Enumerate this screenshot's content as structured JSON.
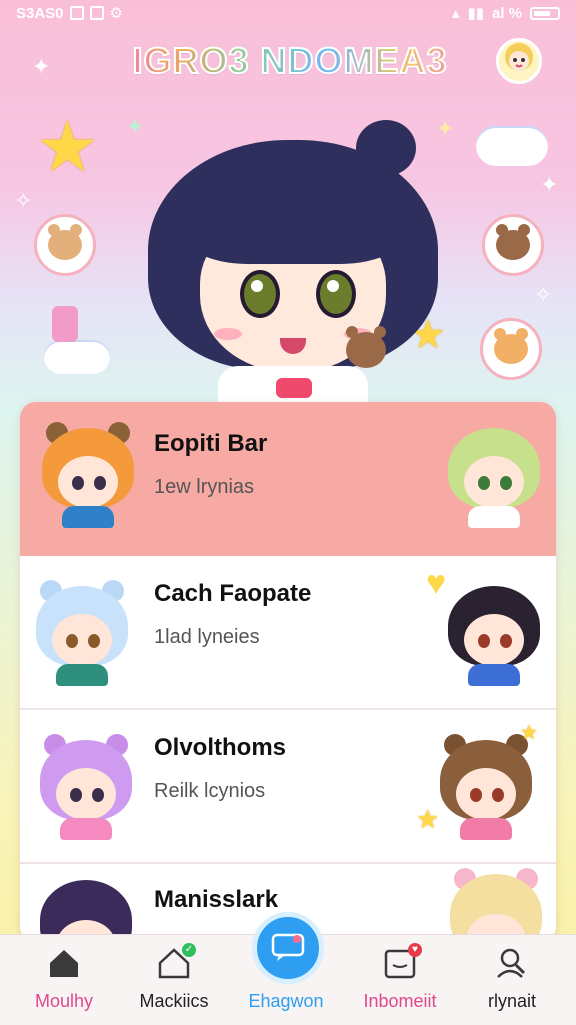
{
  "status_bar": {
    "left_text": "S3AS0",
    "right_text": "al %"
  },
  "app_title": "IGRO3 NDOMEA3",
  "list": [
    {
      "title": "Eopiti Bar",
      "subtitle": "1ew lrynias"
    },
    {
      "title": "Cach Faopate",
      "subtitle": "1lad lyneies"
    },
    {
      "title": "Olvolthoms",
      "subtitle": "Reilk lcynios"
    },
    {
      "title": "Manisslark",
      "subtitle": ""
    }
  ],
  "nav": {
    "items": [
      {
        "label": "Moulhy",
        "icon": "home-icon",
        "color": "#e0488b"
      },
      {
        "label": "Mackiics",
        "icon": "house-outline-icon",
        "color": "#222222"
      },
      {
        "label": "Ehagwon",
        "icon": "chat-icon",
        "color": "#2e9ef0"
      },
      {
        "label": "Inbomeiit",
        "icon": "inbox-icon",
        "color": "#e0488b"
      },
      {
        "label": "rlynait",
        "icon": "profile-search-icon",
        "color": "#222222"
      }
    ]
  },
  "colors": {
    "selected_row": "#f7a9a3",
    "accent_blue": "#2e9ef0",
    "accent_pink": "#e0488b"
  }
}
